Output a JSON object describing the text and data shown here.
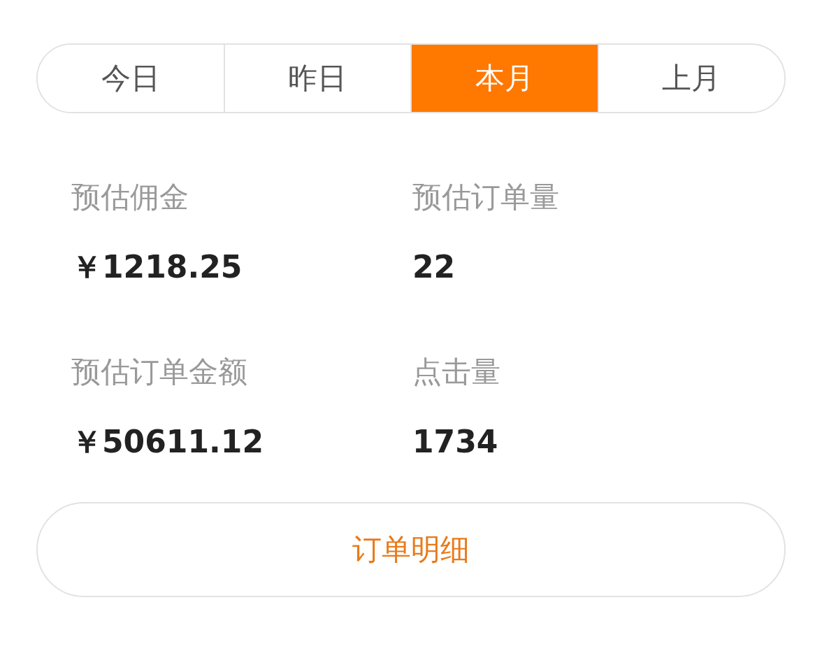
{
  "tabs": [
    {
      "label": "今日",
      "selected": false
    },
    {
      "label": "昨日",
      "selected": false
    },
    {
      "label": "本月",
      "selected": true
    },
    {
      "label": "上月",
      "selected": false
    }
  ],
  "stats": [
    {
      "label": "预估佣金",
      "value": "￥1218.25"
    },
    {
      "label": "预估订单量",
      "value": "22"
    },
    {
      "label": "预估订单金额",
      "value": "￥50611.12"
    },
    {
      "label": "点击量",
      "value": "1734"
    }
  ],
  "button": "订单明细"
}
